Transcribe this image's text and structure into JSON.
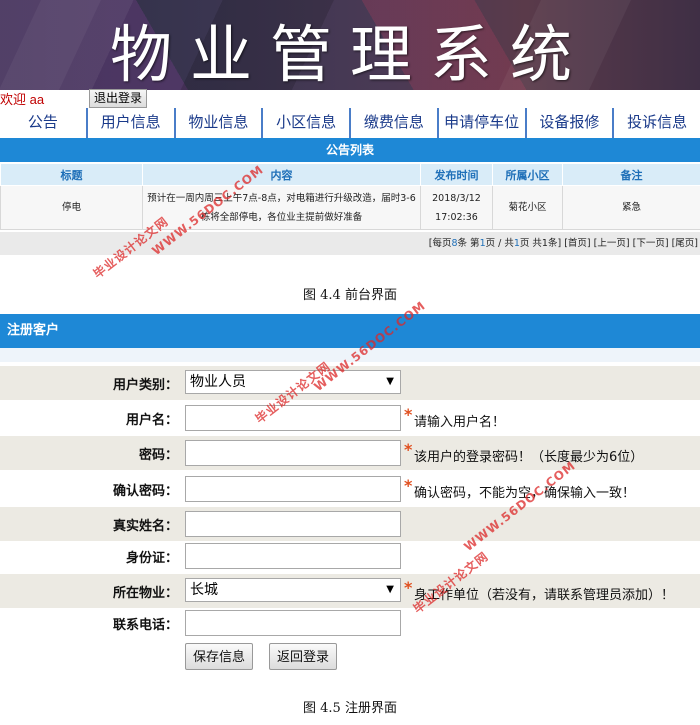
{
  "banner": {
    "title": "物业管理系统"
  },
  "welcome": {
    "text": "欢迎 aa",
    "logout_label": "退出登录"
  },
  "nav": [
    "公告",
    "用户信息",
    "物业信息",
    "小区信息",
    "缴费信息",
    "申请停车位",
    "设备报修",
    "投诉信息"
  ],
  "announcements": {
    "header": "公告列表",
    "columns": [
      "标题",
      "内容",
      "发布时间",
      "所属小区",
      "备注"
    ],
    "rows": [
      {
        "title": "停电",
        "content": "预计在一周内周三上午7点-8点，对电箱进行升级改造，届时3-6栋将全部停电，各位业主提前做好准备",
        "time": "2018/3/12 17:02:36",
        "community": "菊花小区",
        "note": "紧急"
      }
    ],
    "pager": {
      "per_page_prefix": "[每页",
      "per_page": "8",
      "per_page_suffix": "条 第",
      "current": "1",
      "mid": "页 / 共",
      "total_pages": "1",
      "tail": "页 共1条]",
      "first": "[首页]",
      "prev": "[上一页]",
      "next": "[下一页]",
      "last": "[尾页]"
    }
  },
  "captions": {
    "fig44": "图 4.4 前台界面",
    "fig45": "图 4.5 注册界面"
  },
  "register": {
    "header": "注册客户",
    "user_type": {
      "label": "用户类别：",
      "value": "物业人员"
    },
    "username": {
      "label": "用户名：",
      "value": "",
      "required": "*",
      "hint": "请输入用户名！"
    },
    "password": {
      "label": "密码：",
      "value": "",
      "required": "*",
      "hint": "该用户的登录密码！（长度最少为6位）"
    },
    "confirm": {
      "label": "确认密码：",
      "value": "",
      "required": "*",
      "hint": "确认密码，不能为空，确保输入一致！"
    },
    "realname": {
      "label": "真实姓名：",
      "value": ""
    },
    "idcard": {
      "label": "身份证：",
      "value": ""
    },
    "property": {
      "label": "所在物业：",
      "value": "长城",
      "required": "*",
      "hint": "身工作单位（若没有，请联系管理员添加）！"
    },
    "phone": {
      "label": "联系电话：",
      "value": ""
    },
    "save_label": "保存信息",
    "back_label": "返回登录"
  },
  "watermarks": {
    "site": "WWW.56DOC.COM",
    "name": "毕业设计论文网"
  },
  "colors": {
    "header_blue": "#1e88d6",
    "nav_text": "#1a3a8a",
    "welcome_red": "#c00000",
    "required": "#e05020"
  }
}
